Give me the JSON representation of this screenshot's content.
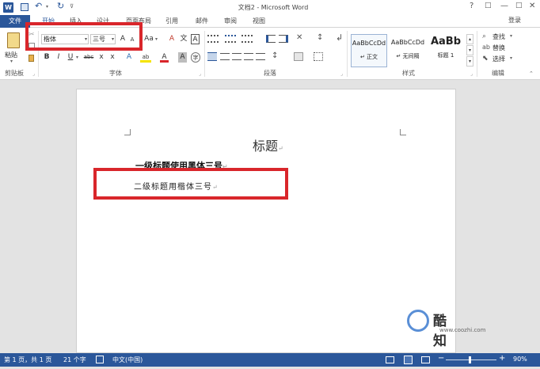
{
  "titlebar": {
    "title": "文档2 - Microsoft Word",
    "help": "?",
    "restore": "□",
    "minimize": "—",
    "maximize": "□",
    "close": "✕",
    "login": "登录"
  },
  "tabs": [
    {
      "label": "文件"
    },
    {
      "label": "开始"
    },
    {
      "label": "插入"
    },
    {
      "label": "设计"
    },
    {
      "label": "页面布局"
    },
    {
      "label": "引用"
    },
    {
      "label": "邮件"
    },
    {
      "label": "审阅"
    },
    {
      "label": "视图"
    }
  ],
  "ribbon": {
    "clipboard": {
      "paste_label": "粘贴",
      "group_label": "剪贴板"
    },
    "font": {
      "font_name": "楷体",
      "font_size": "三号",
      "grow": "A",
      "shrink": "A",
      "case": "Aa",
      "clear": "A",
      "pinyin": "文",
      "border_char": "A",
      "bold": "B",
      "italic": "I",
      "underline": "U",
      "strike": "abc",
      "sub": "x",
      "sup": "x",
      "effects": "A",
      "highlight": "ab",
      "color": "A",
      "shade": "A",
      "circle": "字",
      "group_label": "字体"
    },
    "paragraph": {
      "group_label": "段落"
    },
    "styles": {
      "items": [
        {
          "preview": "AaBbCcDd",
          "label": "↵ 正文"
        },
        {
          "preview": "AaBbCcDd",
          "label": "↵ 无间隔"
        },
        {
          "preview": "AaBb",
          "label": "标题 1"
        }
      ],
      "group_label": "样式"
    },
    "editing": {
      "find": "查找",
      "replace": "替换",
      "select": "选择",
      "group_label": "编辑"
    }
  },
  "document": {
    "title_line": "标题",
    "heading1": "一级标题使用黑体三号",
    "heading2": "二级标题用楷体三号"
  },
  "statusbar": {
    "page": "第 1 页，共 1 页",
    "words": "21 个字",
    "language": "中文(中国)",
    "zoom": "90%",
    "minus": "−",
    "plus": "+"
  },
  "watermark": {
    "brand": "酷知网",
    "url": "www.coozhi.com"
  },
  "colors": {
    "accent": "#2b579a",
    "highlight_box": "#d9262b"
  }
}
